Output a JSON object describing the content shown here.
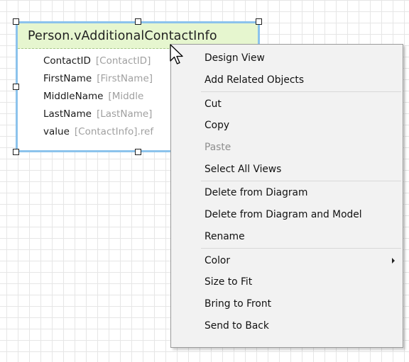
{
  "entity": {
    "title": "Person.vAdditionalContactInfo",
    "fields": [
      {
        "name": "ContactID",
        "expression": "[ContactID]"
      },
      {
        "name": "FirstName",
        "expression": "[FirstName]"
      },
      {
        "name": "MiddleName",
        "expression": "[Middle"
      },
      {
        "name": "LastName",
        "expression": "[LastName]"
      },
      {
        "name": "value",
        "expression": "[ContactInfo].ref"
      }
    ]
  },
  "context_menu": {
    "items": [
      {
        "label": "Design View",
        "enabled": true
      },
      {
        "label": "Add Related Objects",
        "enabled": true
      },
      {
        "label": "Cut",
        "enabled": true
      },
      {
        "label": "Copy",
        "enabled": true
      },
      {
        "label": "Paste",
        "enabled": false
      },
      {
        "label": "Select All Views",
        "enabled": true
      },
      {
        "label": "Delete from Diagram",
        "enabled": true
      },
      {
        "label": "Delete from Diagram and Model",
        "enabled": true
      },
      {
        "label": "Rename",
        "enabled": true
      },
      {
        "label": "Color",
        "enabled": true,
        "submenu": true
      },
      {
        "label": "Size to Fit",
        "enabled": true
      },
      {
        "label": "Bring to Front",
        "enabled": true
      },
      {
        "label": "Send to Back",
        "enabled": true
      }
    ]
  },
  "colors": {
    "grid_line": "#e6e6e6",
    "entity_border": "#8cc3ec",
    "entity_header": "#e6f6cf",
    "menu_background": "#f2f2f2",
    "menu_border": "#9a9a9a",
    "disabled_text": "#8e8e8e"
  },
  "icons": {
    "cursor": "arrow-pointer-icon",
    "submenu": "triangle-right-icon"
  }
}
